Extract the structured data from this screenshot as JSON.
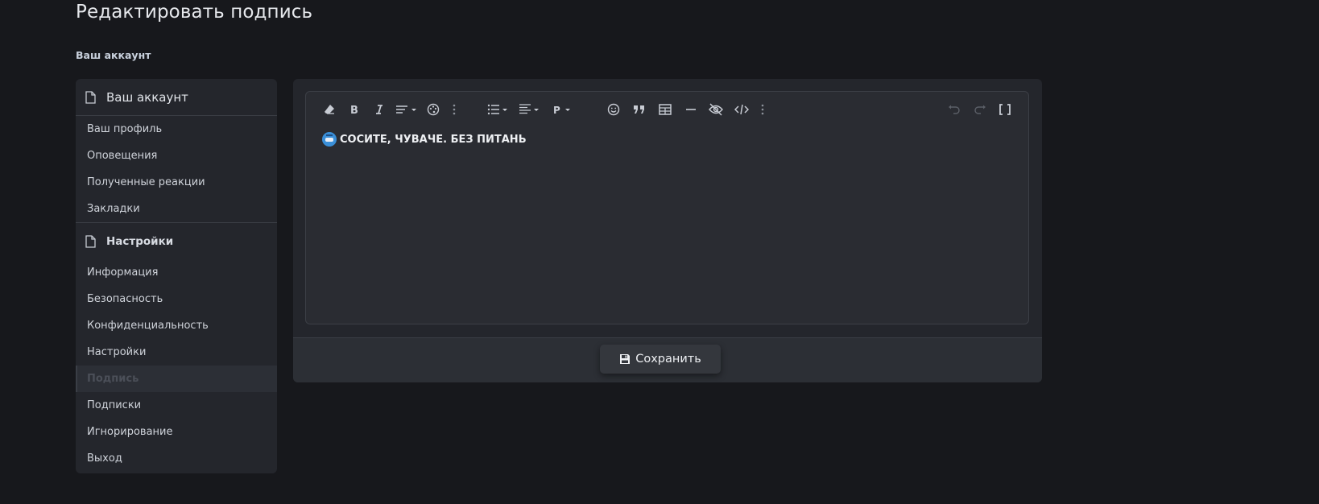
{
  "page": {
    "title": "Редактировать подпись",
    "breadcrumb": "Ваш аккаунт"
  },
  "sidebar": {
    "account_header": "Ваш аккаунт",
    "account_items": [
      {
        "label": "Ваш профиль"
      },
      {
        "label": "Оповещения"
      },
      {
        "label": "Полученные реакции"
      },
      {
        "label": "Закладки"
      }
    ],
    "settings_header": "Настройки",
    "settings_items": [
      {
        "label": "Информация"
      },
      {
        "label": "Безопасность"
      },
      {
        "label": "Конфиденциальность"
      },
      {
        "label": "Настройки"
      },
      {
        "label": "Подпись",
        "active": true
      },
      {
        "label": "Подписки"
      },
      {
        "label": "Игнорирование"
      },
      {
        "label": "Выход"
      }
    ]
  },
  "editor": {
    "content": "СОСИТЕ, ЧУВАЧЕ. БЕЗ ПИТАНЬ",
    "toolbar": [
      "eraser-icon",
      "bold-icon",
      "italic-icon",
      "text-style-icon",
      "palette-icon",
      "more-icon",
      "list-icon",
      "align-icon",
      "paragraph-icon",
      "emoji-icon",
      "quote-icon",
      "table-icon",
      "horizontal-rule-icon",
      "hide-icon",
      "code-icon",
      "more-icon",
      "undo-icon",
      "redo-icon",
      "bbcode-toggle-icon"
    ],
    "paragraph_label": "P"
  },
  "footer": {
    "save_label": "Сохранить"
  },
  "colors": {
    "background": "#17181c",
    "panel": "#24262c",
    "editor": "#2a2c32",
    "text": "#c8ccd4"
  }
}
